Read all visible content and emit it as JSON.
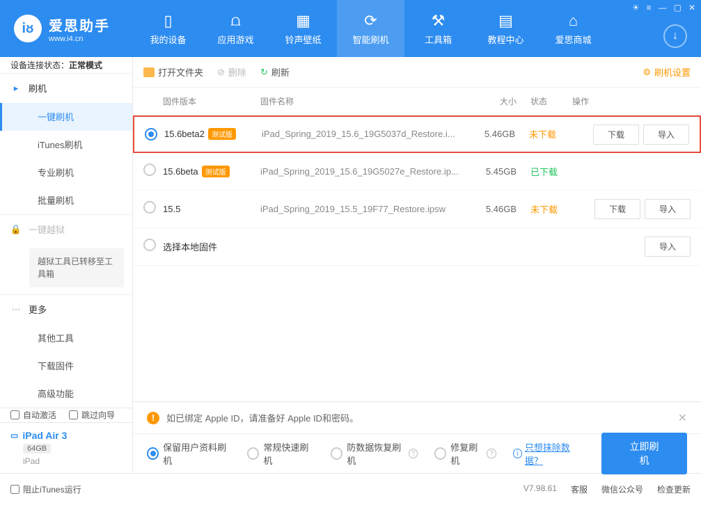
{
  "header": {
    "logo_title": "爱思助手",
    "logo_sub": "www.i4.cn",
    "logo_letter": "iᴕ",
    "tabs": [
      {
        "label": "我的设备"
      },
      {
        "label": "应用游戏"
      },
      {
        "label": "铃声壁纸"
      },
      {
        "label": "智能刷机"
      },
      {
        "label": "工具箱"
      },
      {
        "label": "教程中心"
      },
      {
        "label": "爱思商城"
      }
    ]
  },
  "sidebar": {
    "status_label": "设备连接状态：",
    "status_value": "正常模式",
    "groups": {
      "flash": {
        "title": "刷机",
        "items": [
          {
            "label": "一键刷机"
          },
          {
            "label": "iTunes刷机"
          },
          {
            "label": "专业刷机"
          },
          {
            "label": "批量刷机"
          }
        ]
      },
      "jailbreak": {
        "title": "一键越狱",
        "note": "越狱工具已转移至工具箱"
      },
      "more": {
        "title": "更多",
        "items": [
          {
            "label": "其他工具"
          },
          {
            "label": "下载固件"
          },
          {
            "label": "高级功能"
          }
        ]
      }
    },
    "auto_activate": "自动激活",
    "skip_guide": "跳过向导",
    "device": {
      "name": "iPad Air 3",
      "storage": "64GB",
      "type": "iPad"
    }
  },
  "toolbar": {
    "open_folder": "打开文件夹",
    "delete": "删除",
    "refresh": "刷新",
    "settings": "刷机设置"
  },
  "table": {
    "headers": {
      "version": "固件版本",
      "name": "固件名称",
      "size": "大小",
      "status": "状态",
      "action": "操作"
    },
    "rows": [
      {
        "version": "15.6beta2",
        "badge": "测试版",
        "name": "iPad_Spring_2019_15.6_19G5037d_Restore.i...",
        "size": "5.46GB",
        "status": "未下载",
        "status_type": "orange",
        "selected": true,
        "highlighted": true,
        "actions": true
      },
      {
        "version": "15.6beta",
        "badge": "测试版",
        "name": "iPad_Spring_2019_15.6_19G5027e_Restore.ip...",
        "size": "5.45GB",
        "status": "已下载",
        "status_type": "green",
        "selected": false,
        "actions": false
      },
      {
        "version": "15.5",
        "badge": "",
        "name": "iPad_Spring_2019_15.5_19F77_Restore.ipsw",
        "size": "5.46GB",
        "status": "未下载",
        "status_type": "orange",
        "selected": false,
        "actions": true
      },
      {
        "version": "",
        "badge": "",
        "name_as_version": "选择本地固件",
        "size": "",
        "status": "",
        "selected": false,
        "import_only": true
      }
    ],
    "download_btn": "下载",
    "import_btn": "导入"
  },
  "bottom": {
    "alert": "如已绑定 Apple ID，请准备好 Apple ID和密码。",
    "options": [
      {
        "label": "保留用户资料刷机",
        "checked": true
      },
      {
        "label": "常规快速刷机",
        "checked": false
      },
      {
        "label": "防数据恢复刷机",
        "checked": false,
        "help": true
      },
      {
        "label": "修复刷机",
        "checked": false,
        "help": true
      }
    ],
    "erase_link": "只想抹除数据？",
    "primary_btn": "立即刷机"
  },
  "footer": {
    "block_itunes": "阻止iTunes运行",
    "version": "V7.98.61",
    "items": [
      "客服",
      "微信公众号",
      "检查更新"
    ]
  }
}
